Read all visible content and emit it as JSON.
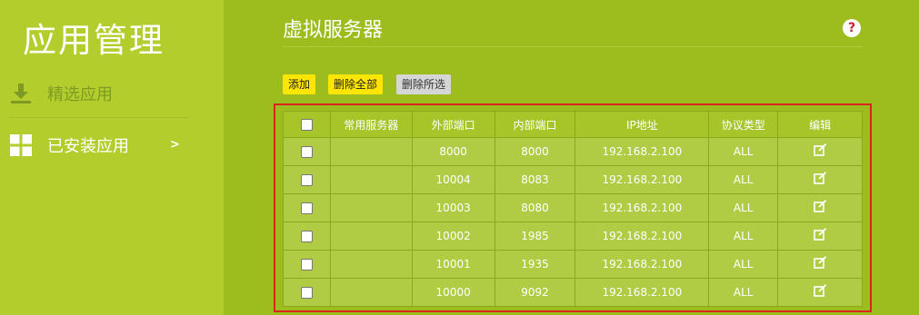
{
  "sidebar": {
    "app_title": "应用管理",
    "items": [
      {
        "label": "精选应用",
        "icon": "download-icon"
      },
      {
        "label": "已安装应用",
        "icon": "apps-grid-icon",
        "chevron": ">"
      }
    ]
  },
  "main": {
    "title": "虚拟服务器",
    "help_icon": "?",
    "toolbar": {
      "add_label": "添加",
      "delete_all_label": "删除全部",
      "delete_selected_label": "删除所选"
    },
    "table": {
      "headers": [
        "常用服务器",
        "外部端口",
        "内部端口",
        "IP地址",
        "协议类型",
        "编辑"
      ],
      "rows": [
        {
          "server": "",
          "external_port": "8000",
          "internal_port": "8000",
          "ip": "192.168.2.100",
          "protocol": "ALL"
        },
        {
          "server": "",
          "external_port": "10004",
          "internal_port": "8083",
          "ip": "192.168.2.100",
          "protocol": "ALL"
        },
        {
          "server": "",
          "external_port": "10003",
          "internal_port": "8080",
          "ip": "192.168.2.100",
          "protocol": "ALL"
        },
        {
          "server": "",
          "external_port": "10002",
          "internal_port": "1985",
          "ip": "192.168.2.100",
          "protocol": "ALL"
        },
        {
          "server": "",
          "external_port": "10001",
          "internal_port": "1935",
          "ip": "192.168.2.100",
          "protocol": "ALL"
        },
        {
          "server": "",
          "external_port": "10000",
          "internal_port": "9092",
          "ip": "192.168.2.100",
          "protocol": "ALL"
        }
      ]
    }
  },
  "colors": {
    "main_bg": "#9dbd1f",
    "sidebar_bg": "#b3cd2c",
    "button_yellow": "#ffe600",
    "frame_red": "#d9251c"
  }
}
